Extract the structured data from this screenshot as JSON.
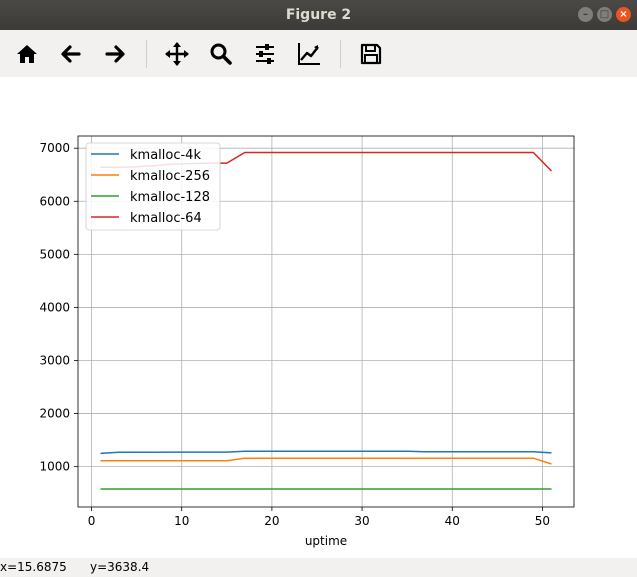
{
  "window": {
    "title": "Figure 2"
  },
  "toolbar": {
    "icons": [
      "home-icon",
      "back-arrow-icon",
      "forward-arrow-icon",
      "pan-icon",
      "zoom-icon",
      "configure-subplots-icon",
      "edit-axis-icon",
      "save-icon"
    ]
  },
  "status": {
    "x_readout": "x=15.6875",
    "y_readout": "y=3638.4"
  },
  "chart_data": {
    "type": "line",
    "xlabel": "uptime",
    "ylabel": "",
    "xlim": [
      -1.5,
      53.5
    ],
    "ylim": [
      240,
      7230
    ],
    "xticks": [
      0,
      10,
      20,
      30,
      40,
      50
    ],
    "yticks": [
      1000,
      2000,
      3000,
      4000,
      5000,
      6000,
      7000
    ],
    "xtick_labels": [
      "0",
      "10",
      "20",
      "30",
      "40",
      "50"
    ],
    "ytick_labels": [
      "1000",
      "2000",
      "3000",
      "4000",
      "5000",
      "6000",
      "7000"
    ],
    "grid": true,
    "legend_position": "upper-left",
    "series": [
      {
        "name": "kmalloc-4k",
        "color": "#1f77b4",
        "x": [
          1,
          3,
          5,
          7,
          9,
          11,
          13,
          15,
          17,
          19,
          21,
          23,
          25,
          27,
          29,
          31,
          33,
          35,
          37,
          39,
          41,
          43,
          45,
          47,
          49,
          51
        ],
        "y": [
          1250,
          1270,
          1270,
          1270,
          1275,
          1275,
          1275,
          1275,
          1290,
          1290,
          1290,
          1290,
          1290,
          1290,
          1290,
          1290,
          1290,
          1290,
          1280,
          1280,
          1280,
          1280,
          1280,
          1280,
          1280,
          1260
        ]
      },
      {
        "name": "kmalloc-256",
        "color": "#ff7f0e",
        "x": [
          1,
          3,
          5,
          7,
          9,
          11,
          13,
          15,
          17,
          19,
          21,
          23,
          25,
          27,
          29,
          31,
          33,
          35,
          37,
          39,
          41,
          43,
          45,
          47,
          49,
          51
        ],
        "y": [
          1110,
          1110,
          1110,
          1110,
          1110,
          1110,
          1110,
          1110,
          1160,
          1160,
          1160,
          1160,
          1160,
          1160,
          1160,
          1160,
          1160,
          1160,
          1160,
          1160,
          1160,
          1160,
          1160,
          1160,
          1160,
          1050
        ]
      },
      {
        "name": "kmalloc-128",
        "color": "#2ca02c",
        "x": [
          1,
          3,
          5,
          7,
          9,
          11,
          13,
          15,
          17,
          19,
          21,
          23,
          25,
          27,
          29,
          31,
          33,
          35,
          37,
          39,
          41,
          43,
          45,
          47,
          49,
          51
        ],
        "y": [
          580,
          580,
          580,
          580,
          580,
          580,
          580,
          580,
          580,
          580,
          580,
          580,
          580,
          580,
          580,
          580,
          580,
          580,
          580,
          580,
          580,
          580,
          580,
          580,
          580,
          580
        ]
      },
      {
        "name": "kmalloc-64",
        "color": "#d62728",
        "x": [
          1,
          3,
          5,
          7,
          9,
          11,
          13,
          15,
          17,
          19,
          21,
          23,
          25,
          27,
          29,
          31,
          33,
          35,
          37,
          39,
          41,
          43,
          45,
          47,
          49,
          51
        ],
        "y": [
          6640,
          6640,
          6650,
          6670,
          6700,
          6710,
          6720,
          6720,
          6920,
          6920,
          6920,
          6920,
          6920,
          6920,
          6920,
          6920,
          6920,
          6920,
          6920,
          6920,
          6920,
          6920,
          6920,
          6920,
          6920,
          6570
        ]
      }
    ]
  }
}
